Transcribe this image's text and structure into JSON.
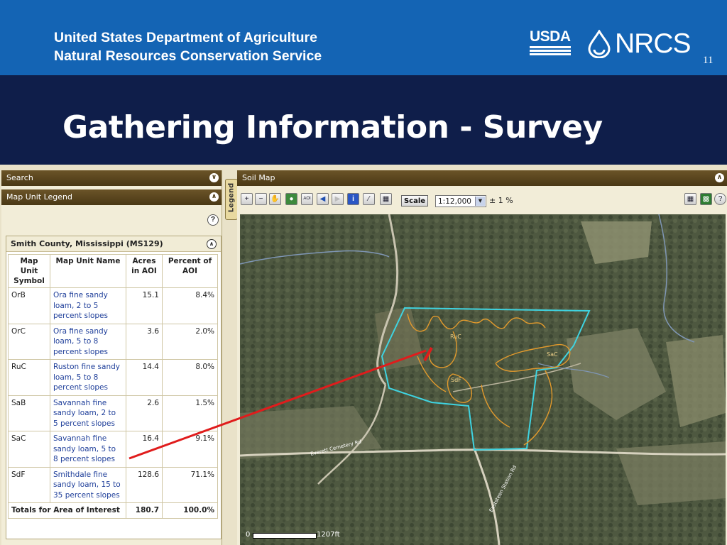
{
  "header": {
    "agency_line1": "United States Department of Agriculture",
    "agency_line2": "Natural Resources Conservation Service",
    "usda_logo": "USDA",
    "nrcs_logo": "NRCS",
    "slide_number": "11"
  },
  "title": "Gathering Information - Survey",
  "left_panel": {
    "search_label": "Search",
    "legend_label": "Map Unit Legend",
    "help_icon": "?",
    "collapse_icon": "up-chevron-icon",
    "aoi_title": "Smith County, Mississippi (MS129)"
  },
  "table": {
    "headers": [
      "Map Unit Symbol",
      "Map Unit Name",
      "Acres in AOI",
      "Percent of AOI"
    ],
    "rows": [
      {
        "symbol": "OrB",
        "name": "Ora fine sandy loam, 2 to 5 percent slopes",
        "acres": "15.1",
        "percent": "8.4%"
      },
      {
        "symbol": "OrC",
        "name": "Ora fine sandy loam, 5 to 8 percent slopes",
        "acres": "3.6",
        "percent": "2.0%"
      },
      {
        "symbol": "RuC",
        "name": "Ruston fine sandy loam, 5 to 8 percent slopes",
        "acres": "14.4",
        "percent": "8.0%"
      },
      {
        "symbol": "SaB",
        "name": "Savannah fine sandy loam, 2 to 5 percent slopes",
        "acres": "2.6",
        "percent": "1.5%"
      },
      {
        "symbol": "SaC",
        "name": "Savannah fine sandy loam, 5 to 8 percent slopes",
        "acres": "16.4",
        "percent": "9.1%"
      },
      {
        "symbol": "SdF",
        "name": "Smithdale fine sandy loam, 15 to 35 percent slopes",
        "acres": "128.6",
        "percent": "71.1%"
      }
    ],
    "totals": {
      "label": "Totals for Area of Interest",
      "acres": "180.7",
      "percent": "100.0%"
    }
  },
  "legend_tab": "Legend",
  "map_panel": {
    "title": "Soil Map",
    "scale_button": "Scale",
    "scale_value": "1:12,000",
    "scale_precision": "± 1 %",
    "tools": [
      "zoom-in-icon",
      "zoom-out-icon",
      "pan-icon",
      "full-extent-icon",
      "zoom-aoi-icon",
      "back-icon",
      "forward-icon",
      "identify-icon",
      "measure-icon",
      "clear-icon"
    ],
    "scalebar_start": "0",
    "scalebar_end": "1207ft",
    "labels": {
      "ruc": "RuC",
      "sac": "SaC",
      "sdf": "SdF",
      "road1": "Everett Cemetery Rd",
      "road2": "Eaststeen Station Rd"
    }
  },
  "colors": {
    "usda_blue": "#1464b4",
    "title_navy": "#0f1e4a",
    "aoi_outline": "#3fd3e0",
    "soil_lines": "#e39a2c",
    "arrow": "#e01c1c"
  }
}
